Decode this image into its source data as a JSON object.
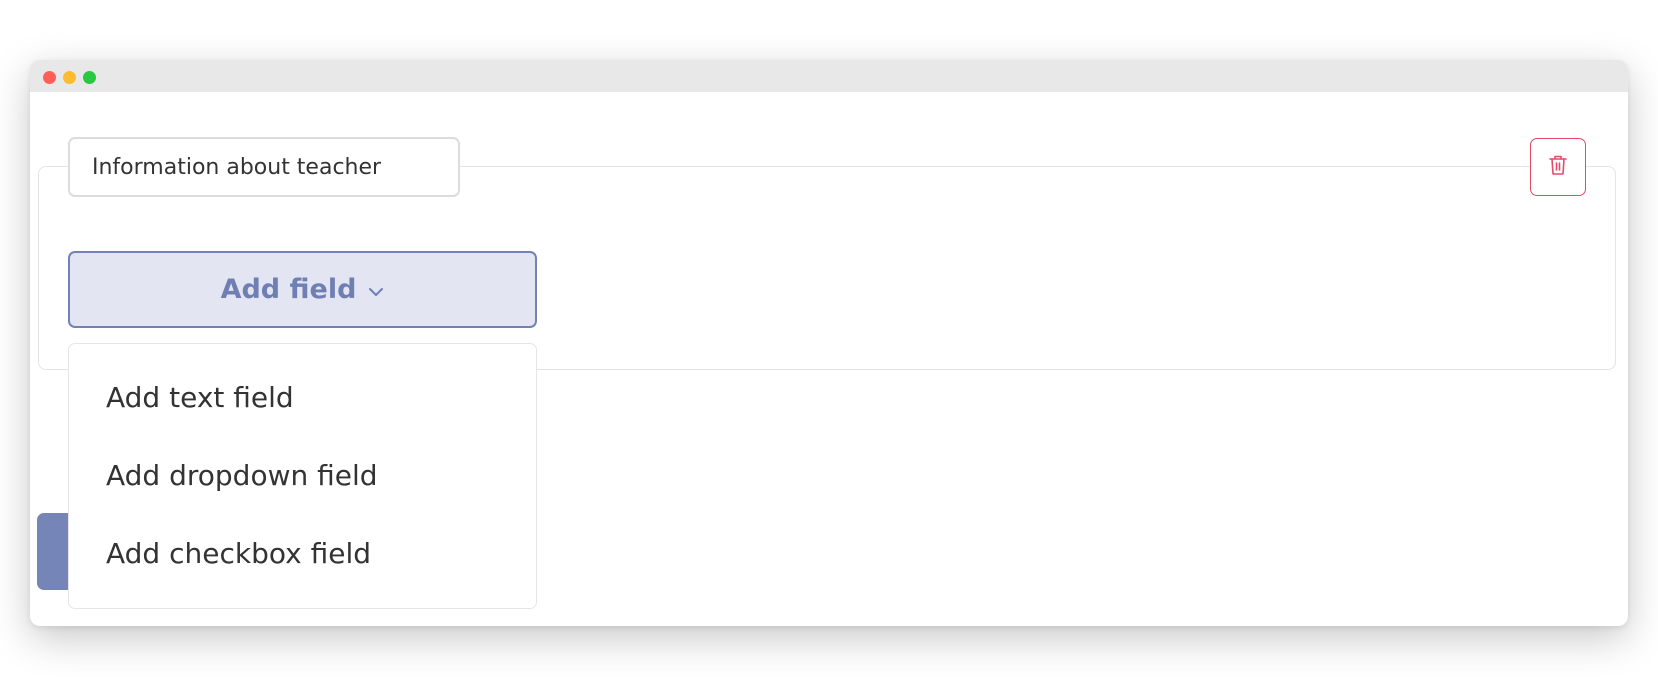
{
  "window": {
    "traffic_lights": [
      "close",
      "minimize",
      "maximize"
    ]
  },
  "section": {
    "title_value": "Information about teacher",
    "delete_icon": "trash-icon"
  },
  "add_field": {
    "label": "Add field",
    "icon": "chevron-down-icon"
  },
  "menu": {
    "items": [
      {
        "label": "Add text field"
      },
      {
        "label": "Add dropdown field"
      },
      {
        "label": "Add checkbox field"
      }
    ]
  },
  "colors": {
    "accent": "#7382b5",
    "accent_bg": "#e3e6f2",
    "danger": "#e54b6b"
  }
}
